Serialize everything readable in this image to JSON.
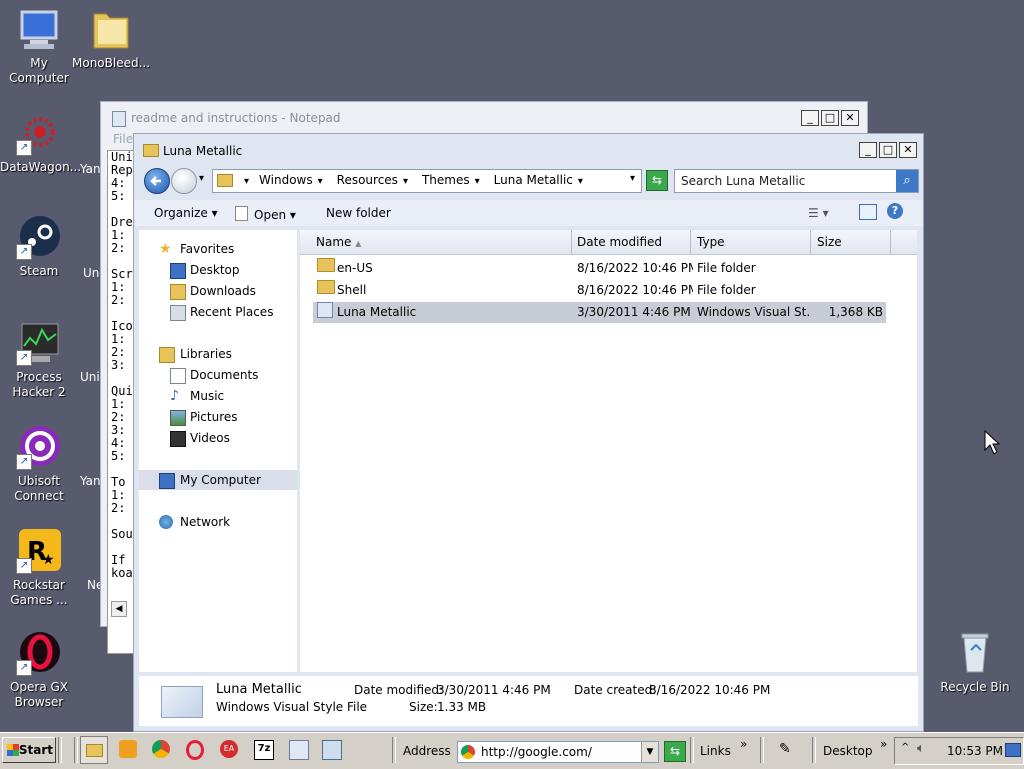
{
  "desktop": {
    "icons_left": [
      {
        "label": "My Computer",
        "icon": "monitor-icon",
        "shortcut": false
      },
      {
        "label": "DataWagon...",
        "icon": "virus-icon",
        "shortcut": true
      },
      {
        "label": "Steam",
        "icon": "steam-icon",
        "shortcut": true
      },
      {
        "label": "Process Hacker 2",
        "icon": "process-hacker-icon",
        "shortcut": true
      },
      {
        "label": "Ubisoft Connect",
        "icon": "ubisoft-icon",
        "shortcut": true
      },
      {
        "label": "Rockstar Games ...",
        "icon": "rockstar-icon",
        "shortcut": true
      },
      {
        "label": "Opera GX Browser",
        "icon": "opera-gx-icon",
        "shortcut": true
      }
    ],
    "icon_monobleed": {
      "label": "MonoBleed...",
      "icon": "folder-icon"
    },
    "partial_labels": [
      "Yan",
      "Uni",
      "Uni",
      "Yan",
      "Ne"
    ],
    "recycle_bin": {
      "label": "Recycle Bin",
      "icon": "recycle-bin-icon"
    }
  },
  "notepad": {
    "title": "readme and instructions - Notepad",
    "menu_first": "File",
    "text_lines": [
      "Uni",
      "Rep",
      "4:",
      "5:",
      "",
      "Dre",
      "1:",
      "2:",
      "",
      "Scr",
      "1:",
      "2:",
      "",
      "Ico",
      "1:",
      "2:",
      "3:",
      "",
      "Qui",
      "1:",
      "2:",
      "3:",
      "4:",
      "5:",
      "",
      "To",
      "1:",
      "2:",
      "",
      "Sou",
      "",
      "If",
      "koa"
    ]
  },
  "explorer": {
    "title": "Luna Metallic",
    "breadcrumb": [
      "Windows",
      "Resources",
      "Themes",
      "Luna Metallic"
    ],
    "search_placeholder": "Search Luna Metallic",
    "toolbar": {
      "organize": "Organize",
      "open": "Open",
      "new_folder": "New folder"
    },
    "nav": {
      "favorites_header": "Favorites",
      "favorites": [
        "Desktop",
        "Downloads",
        "Recent Places"
      ],
      "libraries_header": "Libraries",
      "libraries": [
        "Documents",
        "Music",
        "Pictures",
        "Videos"
      ],
      "computer": "My Computer",
      "network": "Network"
    },
    "columns": {
      "name": "Name",
      "date": "Date modified",
      "type": "Type",
      "size": "Size"
    },
    "files": [
      {
        "name": "en-US",
        "date": "8/16/2022 10:46 PM",
        "type": "File folder",
        "size": "",
        "kind": "folder"
      },
      {
        "name": "Shell",
        "date": "8/16/2022 10:46 PM",
        "type": "File folder",
        "size": "",
        "kind": "folder"
      },
      {
        "name": "Luna Metallic",
        "date": "3/30/2011 4:46 PM",
        "type": "Windows Visual St...",
        "size": "1,368 KB",
        "kind": "file"
      }
    ],
    "details": {
      "name": "Luna Metallic",
      "type": "Windows Visual Style File",
      "modified_label": "Date modified:",
      "modified_value": "3/30/2011 4:46 PM",
      "size_label": "Size:",
      "size_value": "1.33 MB",
      "created_label": "Date created:",
      "created_value": "8/16/2022 10:46 PM"
    }
  },
  "taskbar": {
    "start": "Start",
    "address_label": "Address",
    "address_value": "http://google.com/",
    "links": "Links",
    "desktop": "Desktop",
    "clock": "10:53 PM"
  }
}
